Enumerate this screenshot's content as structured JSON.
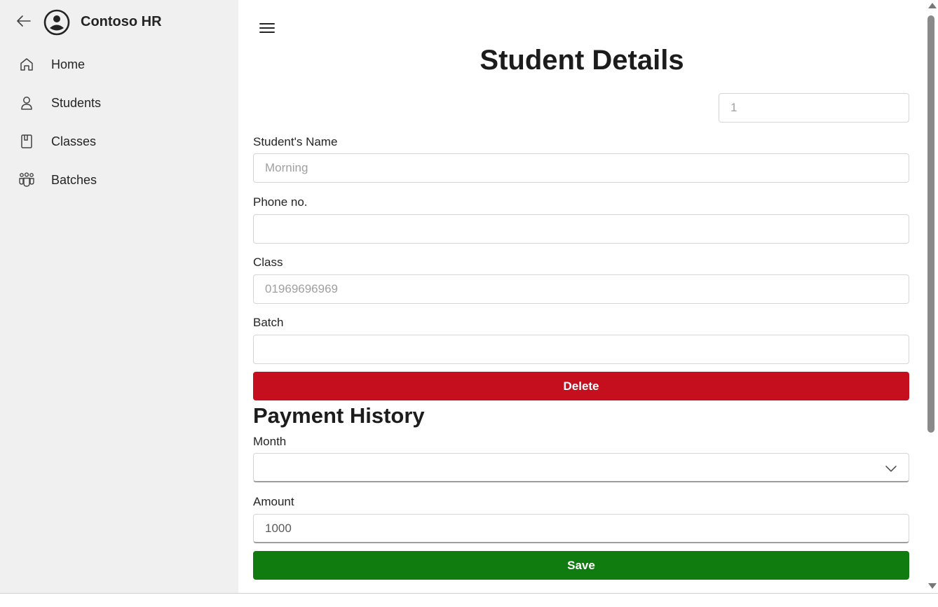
{
  "app": {
    "title": "Contoso HR"
  },
  "sidebar": {
    "items": [
      {
        "label": "Home",
        "icon": "home-icon"
      },
      {
        "label": "Students",
        "icon": "person-icon"
      },
      {
        "label": "Classes",
        "icon": "book-icon"
      },
      {
        "label": "Batches",
        "icon": "people-team-icon"
      }
    ]
  },
  "main": {
    "title": "Student Details",
    "id_field": {
      "placeholder": "1"
    },
    "fields": {
      "name": {
        "label": "Student's Name",
        "placeholder": "Morning"
      },
      "phone": {
        "label": "Phone no.",
        "value": ""
      },
      "class": {
        "label": "Class",
        "placeholder": "01969696969"
      },
      "batch": {
        "label": "Batch",
        "value": ""
      }
    },
    "delete_label": "Delete",
    "payment": {
      "title": "Payment History",
      "month_label": "Month",
      "month_value": "",
      "amount_label": "Amount",
      "amount_value": "1000",
      "save_label": "Save"
    }
  },
  "colors": {
    "delete": "#c50f1f",
    "save": "#107c10",
    "sidebar_bg": "#f0f0f0"
  }
}
